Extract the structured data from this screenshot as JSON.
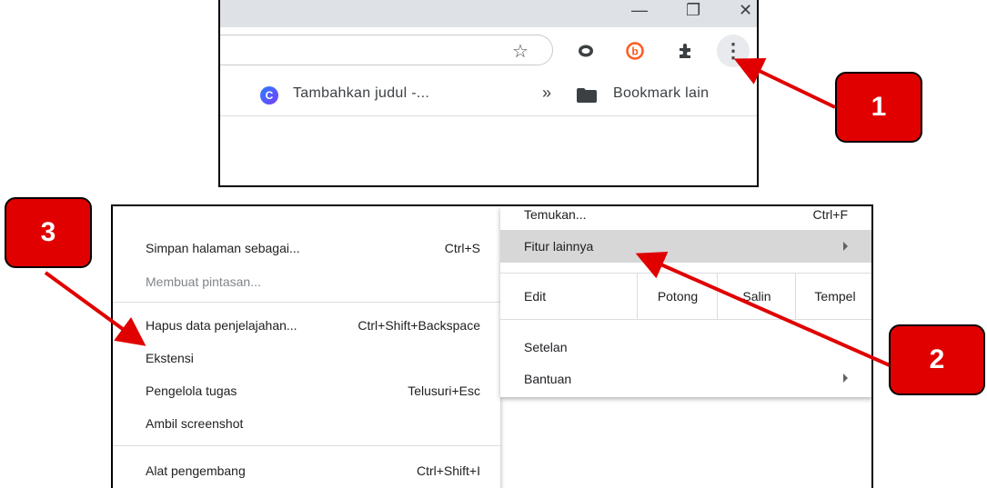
{
  "toolbar": {
    "window_controls": [
      "—",
      "❐",
      "✕"
    ],
    "icons": [
      "star-icon",
      "extension-o-icon",
      "extension-b-icon",
      "puzzle-icon",
      "kebab-menu-icon"
    ],
    "menu_glyph": "⋮",
    "star_glyph": "☆",
    "puzzle_glyph": "✚"
  },
  "bookmarks": {
    "item_label": "Tambahkan judul -...",
    "chevron": "»",
    "other_label": "Bookmark lain",
    "favicon_letter": "C"
  },
  "main_menu": {
    "find": {
      "label": "Temukan...",
      "shortcut": "Ctrl+F"
    },
    "more_tools": {
      "label": "Fitur lainnya"
    },
    "edit": {
      "label": "Edit",
      "cut": "Potong",
      "copy": "Salin",
      "paste": "Tempel"
    },
    "settings": {
      "label": "Setelan"
    },
    "help": {
      "label": "Bantuan"
    }
  },
  "sub_menu": {
    "save_page": {
      "label": "Simpan halaman sebagai...",
      "shortcut": "Ctrl+S"
    },
    "create_shortcut": {
      "label": "Membuat pintasan..."
    },
    "clear_data": {
      "label": "Hapus data penjelajahan...",
      "shortcut": "Ctrl+Shift+Backspace"
    },
    "extensions": {
      "label": "Ekstensi"
    },
    "task_manager": {
      "label": "Pengelola tugas",
      "shortcut": "Telusuri+Esc"
    },
    "screenshot": {
      "label": "Ambil screenshot"
    },
    "dev_tools": {
      "label": "Alat pengembang",
      "shortcut": "Ctrl+Shift+I"
    }
  },
  "callouts": {
    "one": "1",
    "two": "2",
    "three": "3"
  },
  "colors": {
    "callout": "#e00000",
    "arrow": "#e00000",
    "highlight": "#d7d7d7"
  }
}
